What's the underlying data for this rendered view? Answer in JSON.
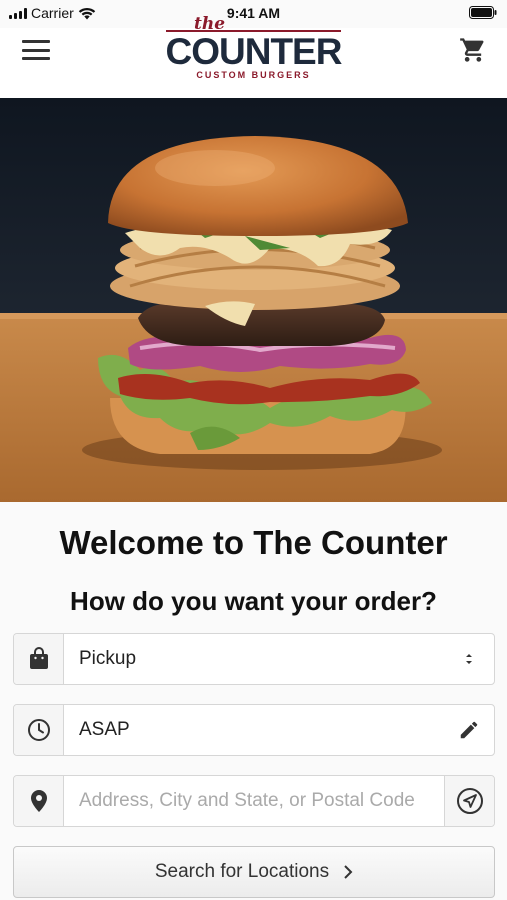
{
  "status_bar": {
    "carrier": "Carrier",
    "time": "9:41 AM"
  },
  "header": {
    "logo": {
      "the": "the",
      "name": "COUNTER",
      "tagline": "CUSTOM BURGERS"
    }
  },
  "main": {
    "welcome_title": "Welcome to The Counter",
    "order_question": "How do you want your order?",
    "order_type": {
      "selected": "Pickup",
      "icon": "bag-icon"
    },
    "time": {
      "value": "ASAP",
      "icon": "clock-icon"
    },
    "address": {
      "placeholder": "Address, City and State, or Postal Code",
      "value": "",
      "icon": "location-pin-icon"
    },
    "search_button": {
      "label": "Search for Locations"
    }
  },
  "colors": {
    "brand_red": "#8b1a2b",
    "brand_navy": "#1e2a3c"
  }
}
